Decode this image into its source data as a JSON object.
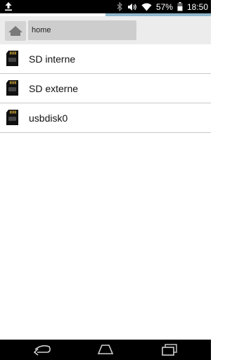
{
  "status_bar": {
    "battery_percent": "57%",
    "time": "18:50",
    "icons": [
      "upload-icon",
      "bluetooth-icon",
      "vibrate-icon",
      "wifi-icon",
      "battery-icon"
    ]
  },
  "path_bar": {
    "home_icon": "home-icon",
    "crumb": "home"
  },
  "list": {
    "items": [
      {
        "label": "SD interne",
        "icon": "sd-card-icon"
      },
      {
        "label": "SD externe",
        "icon": "sd-card-icon"
      },
      {
        "label": "usbdisk0",
        "icon": "sd-card-icon"
      }
    ]
  },
  "nav_bar": {
    "icons": [
      "back-icon",
      "home-nav-icon",
      "recent-apps-icon"
    ]
  },
  "colors": {
    "status_bar": "#000000",
    "accent_strip": "#8fb6cc",
    "path_bar_bg": "#ececec",
    "crumb_bg": "#cdcdcd",
    "divider": "#c8c8c8"
  }
}
